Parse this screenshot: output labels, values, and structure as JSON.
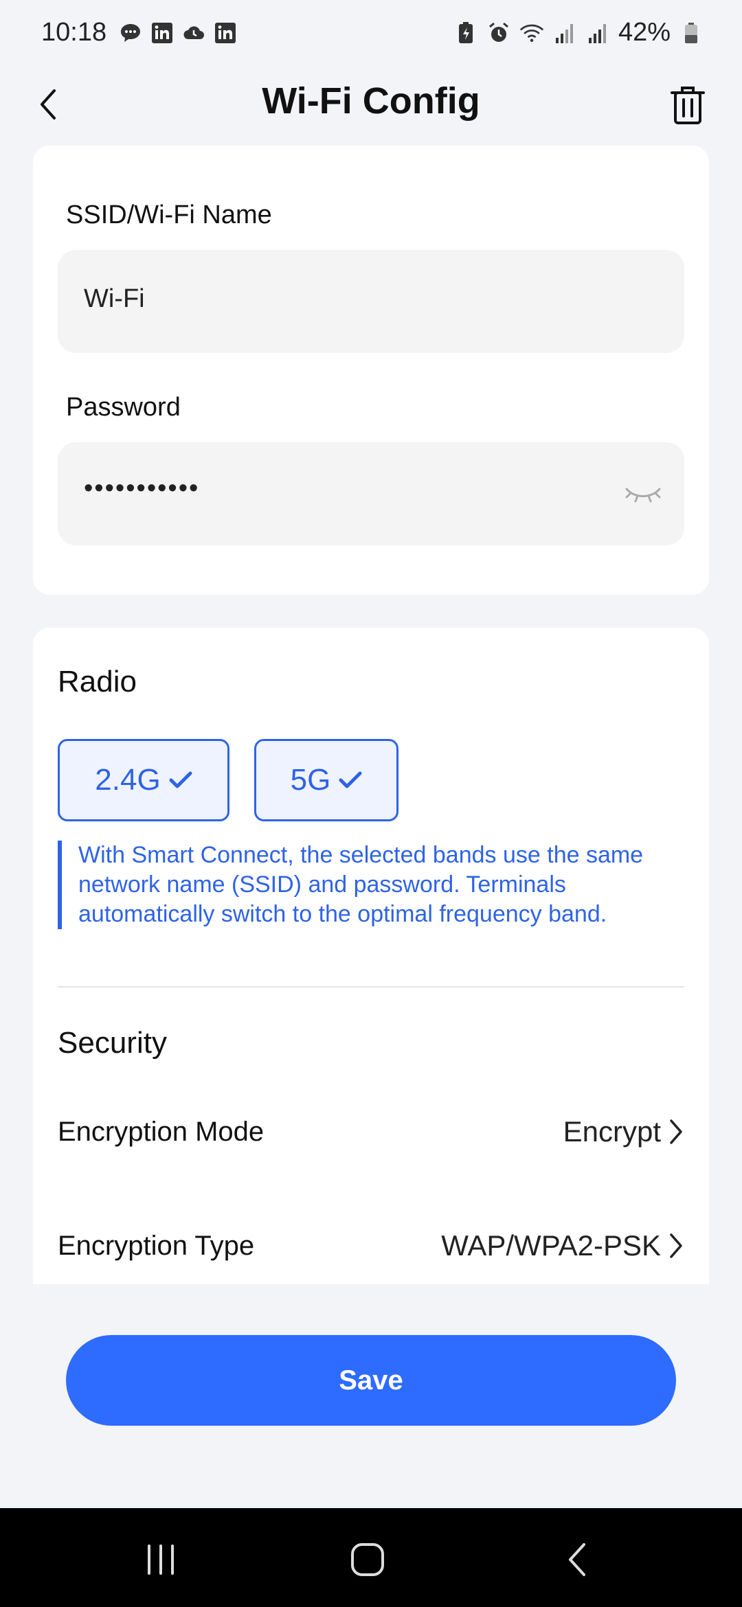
{
  "status_bar": {
    "time": "10:18",
    "battery": "42%",
    "left_icons": [
      "chat-bubble-icon",
      "linkedin-icon",
      "cloud-icon",
      "linkedin-icon"
    ],
    "right_icons": [
      "battery-saver-icon",
      "alarm-icon",
      "wifi-icon",
      "signal-icon",
      "signal-icon",
      "battery-icon"
    ]
  },
  "header": {
    "title": "Wi-Fi Config",
    "back_icon": "chevron-left-icon",
    "delete_icon": "trash-icon"
  },
  "credentials": {
    "ssid_label": "SSID/Wi-Fi Name",
    "ssid_value": "Wi-Fi",
    "password_label": "Password",
    "password_value": "•••••••••••",
    "eye_icon": "eye-closed-icon"
  },
  "radio": {
    "title": "Radio",
    "bands": [
      {
        "label": "2.4G",
        "selected": true
      },
      {
        "label": "5G",
        "selected": true
      }
    ],
    "note": "With Smart Connect, the selected bands use the same network name (SSID) and password. Terminals automatically switch to the optimal frequency band."
  },
  "security": {
    "title": "Security",
    "encryption_mode_label": "Encryption Mode",
    "encryption_mode_value": "Encrypt",
    "encryption_type_label": "Encryption Type",
    "encryption_type_value": "WAP/WPA2-PSK"
  },
  "save_label": "Save",
  "colors": {
    "accent": "#2e63e6",
    "save_button": "#2e6bff",
    "background": "#f3f4f8"
  },
  "nav": {
    "recents_icon": "recents-icon",
    "home_icon": "home-icon",
    "back_icon": "back-icon"
  }
}
